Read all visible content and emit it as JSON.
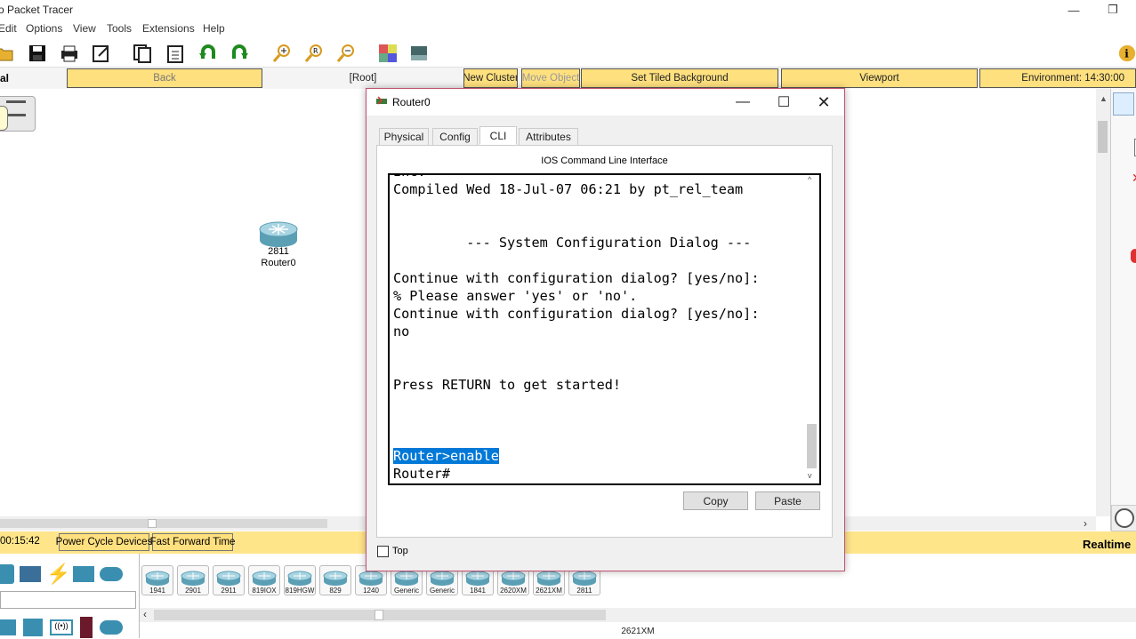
{
  "app": {
    "title": "o Packet Tracer"
  },
  "window_controls": {
    "minimize": "—",
    "restore": "❐"
  },
  "menu": [
    "Edit",
    "Options",
    "View",
    "Tools",
    "Extensions",
    "Help"
  ],
  "toolbar_icons": [
    "open-icon",
    "save-icon",
    "print-icon",
    "activity-wizard-icon",
    "copy-icon",
    "paste-icon",
    "undo-icon",
    "redo-icon",
    "zoom-in-icon",
    "zoom-reset-icon",
    "zoom-out-icon",
    "palette-icon",
    "custom-device-icon",
    "info-icon"
  ],
  "workspace_bar": {
    "logical_label": "al",
    "back": "Back",
    "root": "[Root]",
    "new_cluster": "New Cluster",
    "move_object": "Move Object",
    "tiled_background": "Set Tiled Background",
    "viewport": "Viewport",
    "environment": "Environment: 14:30:00"
  },
  "canvas": {
    "device_model": "2811",
    "device_name": "Router0"
  },
  "status": {
    "time": "00:15:42",
    "power_cycle": "Power Cycle Devices",
    "fast_forward": "Fast Forward Time",
    "mode": "Realtime"
  },
  "device_list": [
    "1941",
    "2901",
    "2911",
    "819IOX",
    "819HGW",
    "829",
    "1240",
    "Generic",
    "Generic",
    "1841",
    "2620XM",
    "2621XM",
    "2811"
  ],
  "selected_device_caption": "2621XM",
  "dialog": {
    "title": "Router0",
    "tabs": [
      "Physical",
      "Config",
      "CLI",
      "Attributes"
    ],
    "active_tab": "CLI",
    "cli_heading": "IOS Command Line Interface",
    "terminal_lines": [
      "Inc.",
      "Compiled Wed 18-Jul-07 06:21 by pt_rel_team",
      "",
      "",
      "         --- System Configuration Dialog ---",
      "",
      "Continue with configuration dialog? [yes/no]:",
      "% Please answer 'yes' or 'no'.",
      "Continue with configuration dialog? [yes/no]:",
      "no",
      "",
      "",
      "Press RETURN to get started!",
      "",
      "",
      "",
      "Router>enable",
      "Router#"
    ],
    "copy_label": "Copy",
    "paste_label": "Paste",
    "top_label": "Top",
    "top_checked": false
  },
  "colors": {
    "accent_yellow": "#ffe07f",
    "selection": "#0078d7",
    "dialog_border": "#c05070"
  }
}
